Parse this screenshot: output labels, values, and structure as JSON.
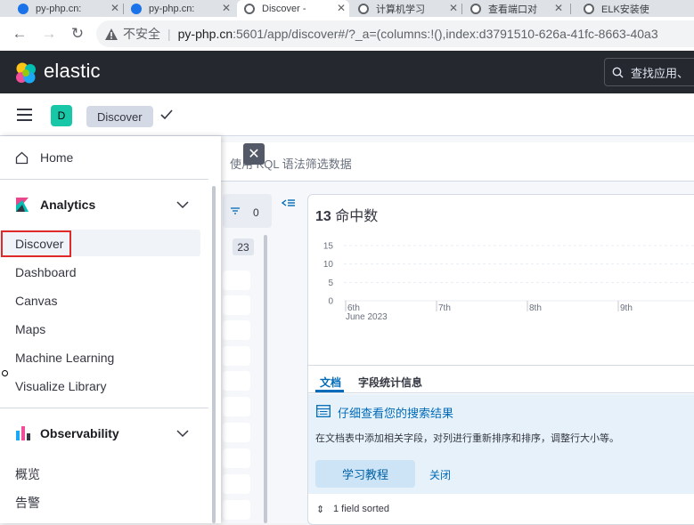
{
  "browser": {
    "tabs": [
      {
        "label": "py-php.cn:"
      },
      {
        "label": "py-php.cn:"
      },
      {
        "label": "Discover -"
      },
      {
        "label": "计算机学习"
      },
      {
        "label": "查看端口对"
      },
      {
        "label": "ELK安装使"
      }
    ],
    "address": {
      "insecure_label": "不安全",
      "separator": "|",
      "host": "py-php.cn",
      "rest": ":5601/app/discover#/?_a=(columns:!(),index:d3791510-626a-41fc-8663-40a3"
    }
  },
  "header": {
    "brand": "elastic",
    "search_placeholder": "查找应用、"
  },
  "breadcrumbs": {
    "space_initial": "D",
    "current": "Discover"
  },
  "query": {
    "placeholder_visible": "使用 KQL 语法筛选数据"
  },
  "fields": {
    "filter_count": "0",
    "available_count": "23"
  },
  "results": {
    "hits_count": "13",
    "hits_label": "命中数",
    "tabs": [
      {
        "label": "文档"
      },
      {
        "label": "字段统计信息"
      }
    ],
    "callout": {
      "title": "仔细查看您的搜索结果",
      "body": "在文档表中添加相关字段，对列进行重新排序和排序，调整行大小等。",
      "primary_button": "学习教程",
      "dismiss": "关闭"
    },
    "sorted_label": "1 field sorted"
  },
  "chart_data": {
    "type": "bar",
    "title": "",
    "xlabel": "",
    "ylabel": "",
    "ylim": [
      0,
      15
    ],
    "y_ticks": [
      "15",
      "10",
      "5",
      "0"
    ],
    "x_ticks": [
      "6th",
      "7th",
      "8th",
      "9th"
    ],
    "x_sub_label": "June 2023",
    "categories": [],
    "values": [],
    "grid": true
  },
  "sidenav": {
    "home": "Home",
    "analytics": {
      "title": "Analytics",
      "items": [
        {
          "label": "Discover"
        },
        {
          "label": "Dashboard"
        },
        {
          "label": "Canvas"
        },
        {
          "label": "Maps"
        },
        {
          "label": "Machine Learning"
        },
        {
          "label": "Visualize Library"
        }
      ]
    },
    "observability": {
      "title": "Observability",
      "items": [
        {
          "label": "概览"
        },
        {
          "label": "告警"
        }
      ]
    }
  },
  "colors": {
    "header_bg": "#25282f",
    "accent": "#006bb8",
    "space_badge": "#17c7a8",
    "highlight_box": "#e02a2a"
  }
}
